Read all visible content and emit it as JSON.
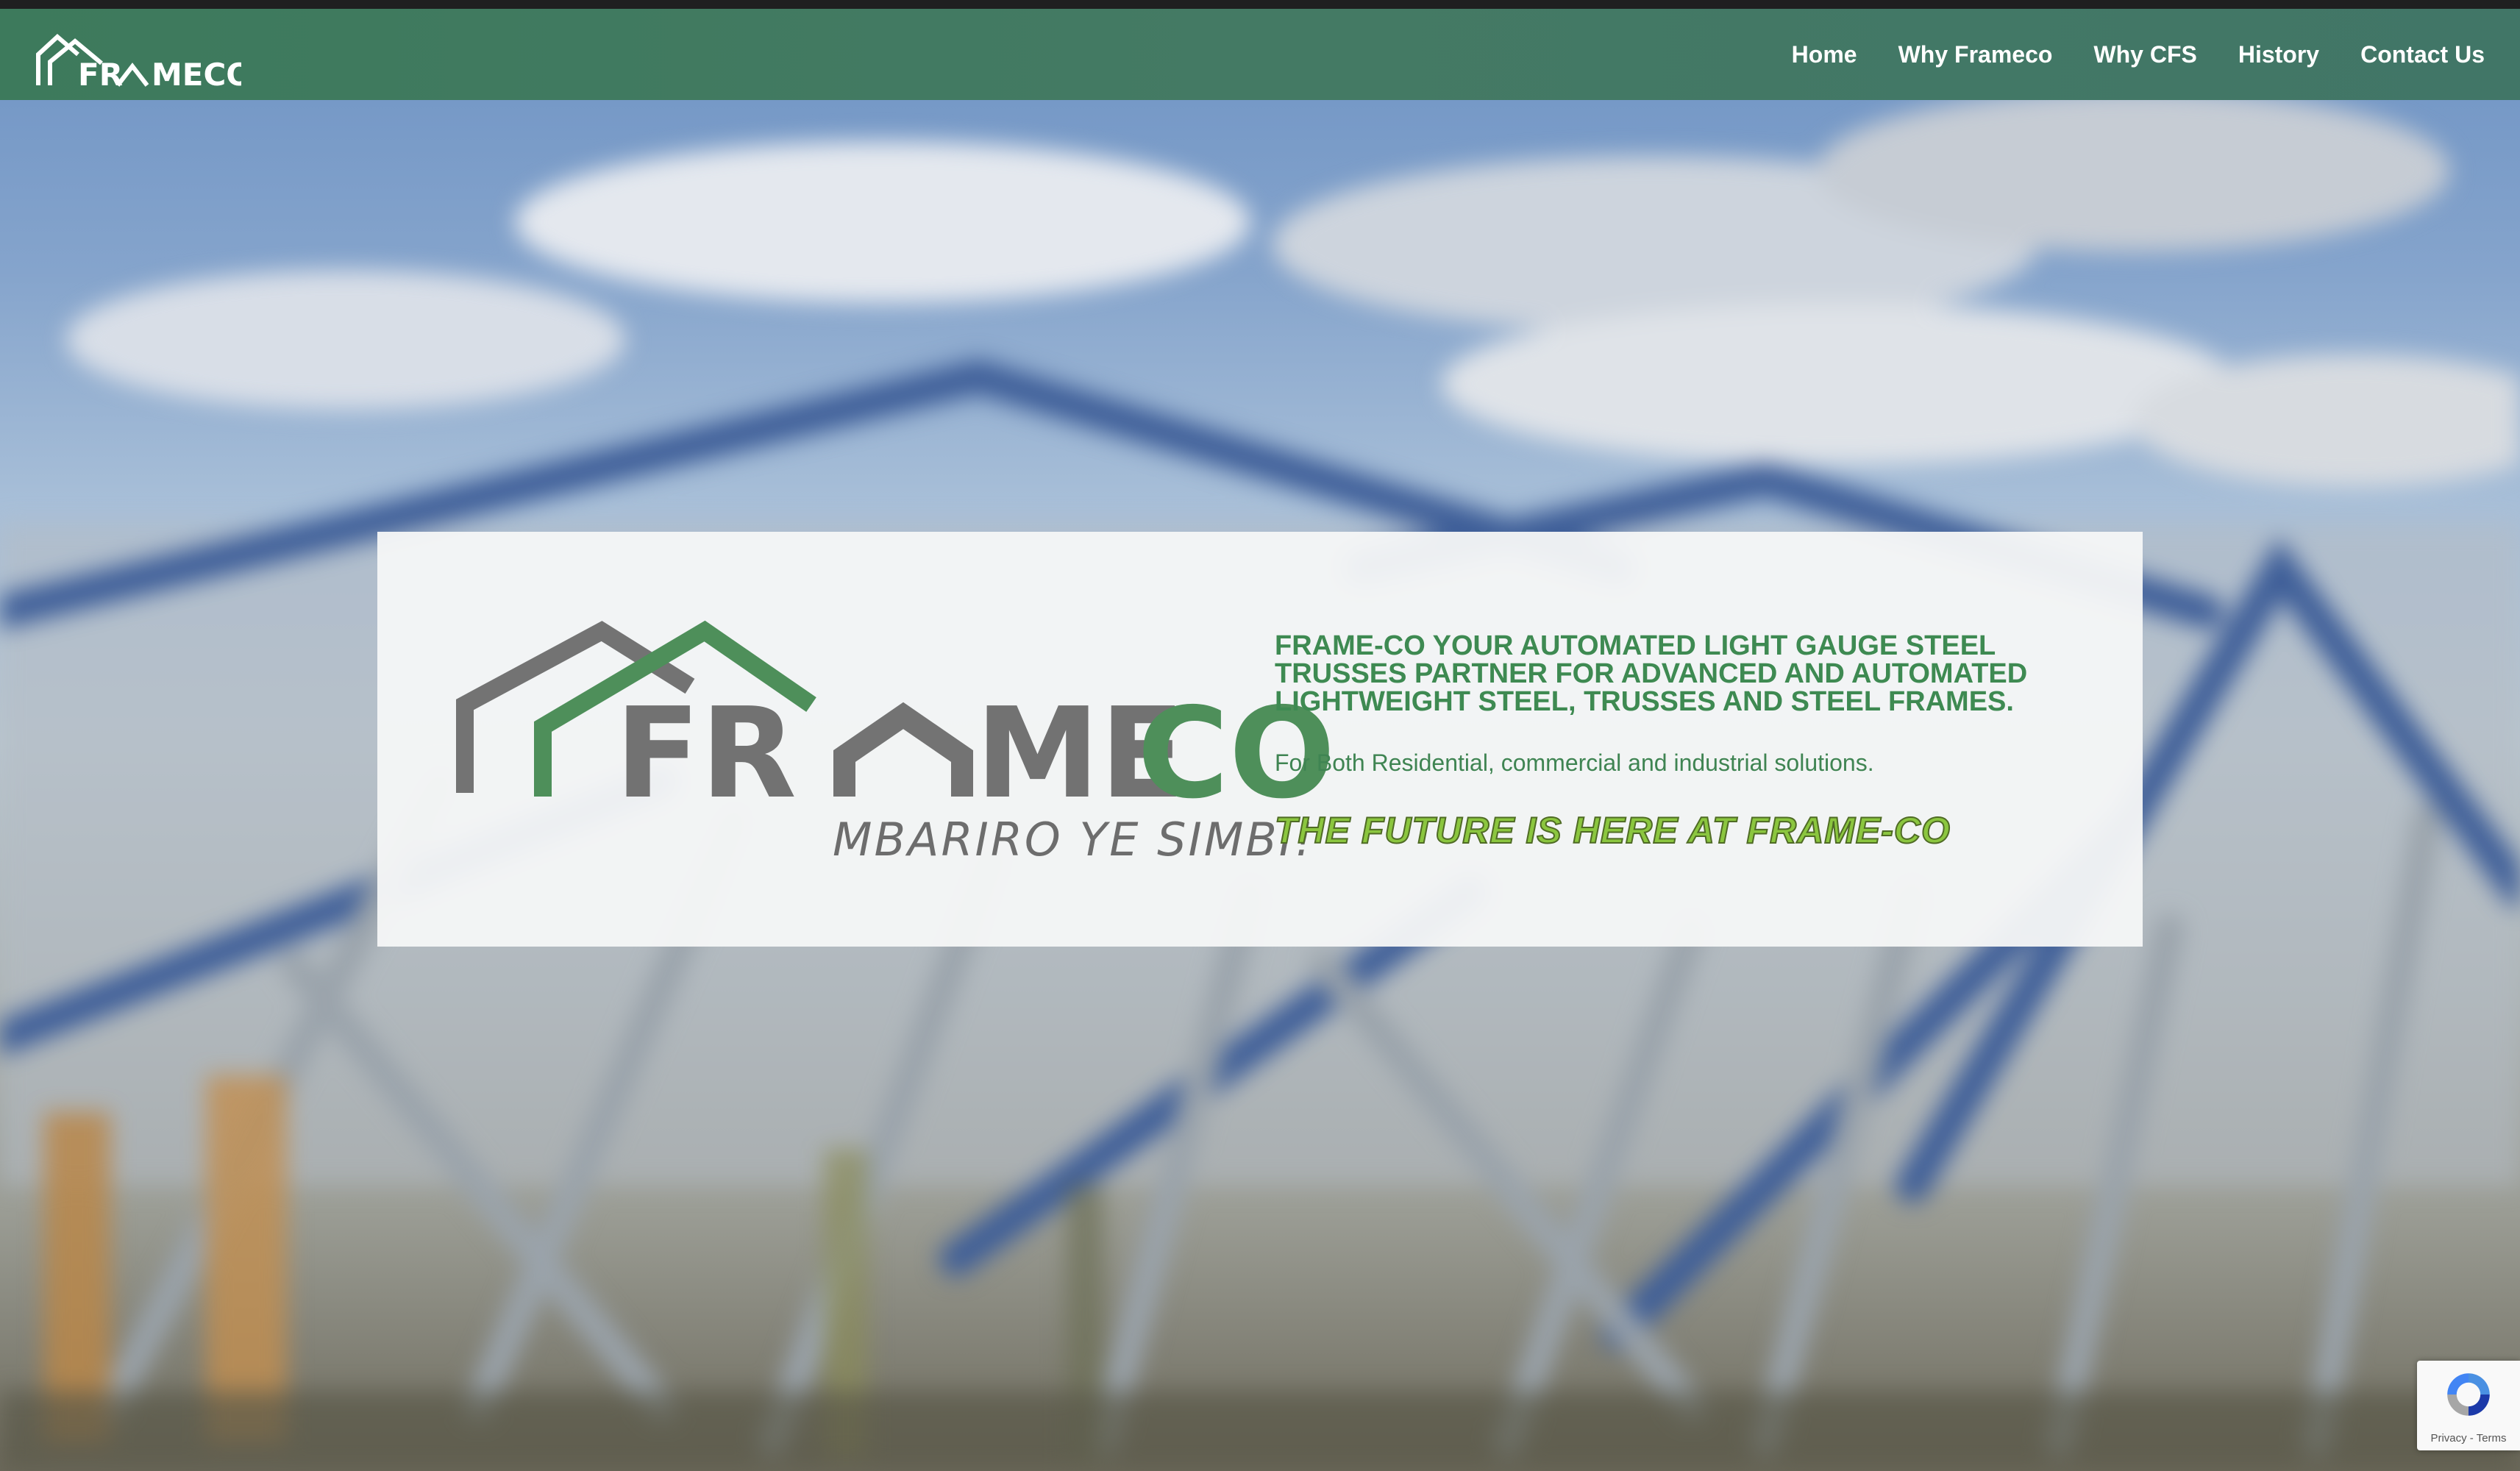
{
  "brand": {
    "name_part1": "FR",
    "name_part2": "MECO",
    "card_name_dark": "FR",
    "card_name_mid": "ME",
    "card_name_green": "CO",
    "slogan": "MBARIRO YE SIMBI!"
  },
  "nav": {
    "items": [
      {
        "label": "Home"
      },
      {
        "label": "Why Frameco"
      },
      {
        "label": "Why CFS"
      },
      {
        "label": "History"
      },
      {
        "label": "Contact Us"
      }
    ]
  },
  "hero": {
    "headline_lines": [
      "FRAME-CO YOUR AUTOMATED LIGHT GAUGE STEEL",
      "TRUSSES PARTNER FOR ADVANCED AND AUTOMATED",
      "LIGHTWEIGHT STEEL, TRUSSES AND STEEL FRAMES."
    ],
    "subline": "For Both Residential, commercial and industrial solutions.",
    "tagline": "THE FUTURE IS HERE AT FRAME-CO"
  },
  "recaptcha": {
    "privacy": "Privacy",
    "separator": " - ",
    "terms": "Terms"
  },
  "colors": {
    "nav_green": "#427a62",
    "brand_green": "#4a8f58",
    "brand_gray": "#707070",
    "headline_green": "#3e8a52",
    "tagline_lime": "#8bc63f"
  }
}
